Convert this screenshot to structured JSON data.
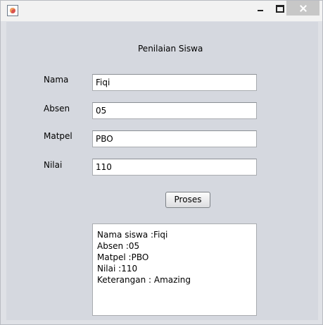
{
  "window": {
    "title": "",
    "controls": [
      "minimize-icon",
      "maximize-icon",
      "close-icon"
    ]
  },
  "form": {
    "heading": "Penilaian Siswa",
    "nama": {
      "label": "Nama",
      "value": "Fiqi"
    },
    "absen": {
      "label": "Absen",
      "value": "05"
    },
    "matpel": {
      "label": "Matpel",
      "value": "PBO"
    },
    "nilai": {
      "label": "Nilai",
      "value": "110"
    },
    "proses_label": "Proses"
  },
  "result": {
    "lines": [
      "Nama siswa :Fiqi",
      "Absen :05",
      "Matpel :PBO",
      "Nilai :110",
      "Keterangan : Amazing"
    ]
  }
}
